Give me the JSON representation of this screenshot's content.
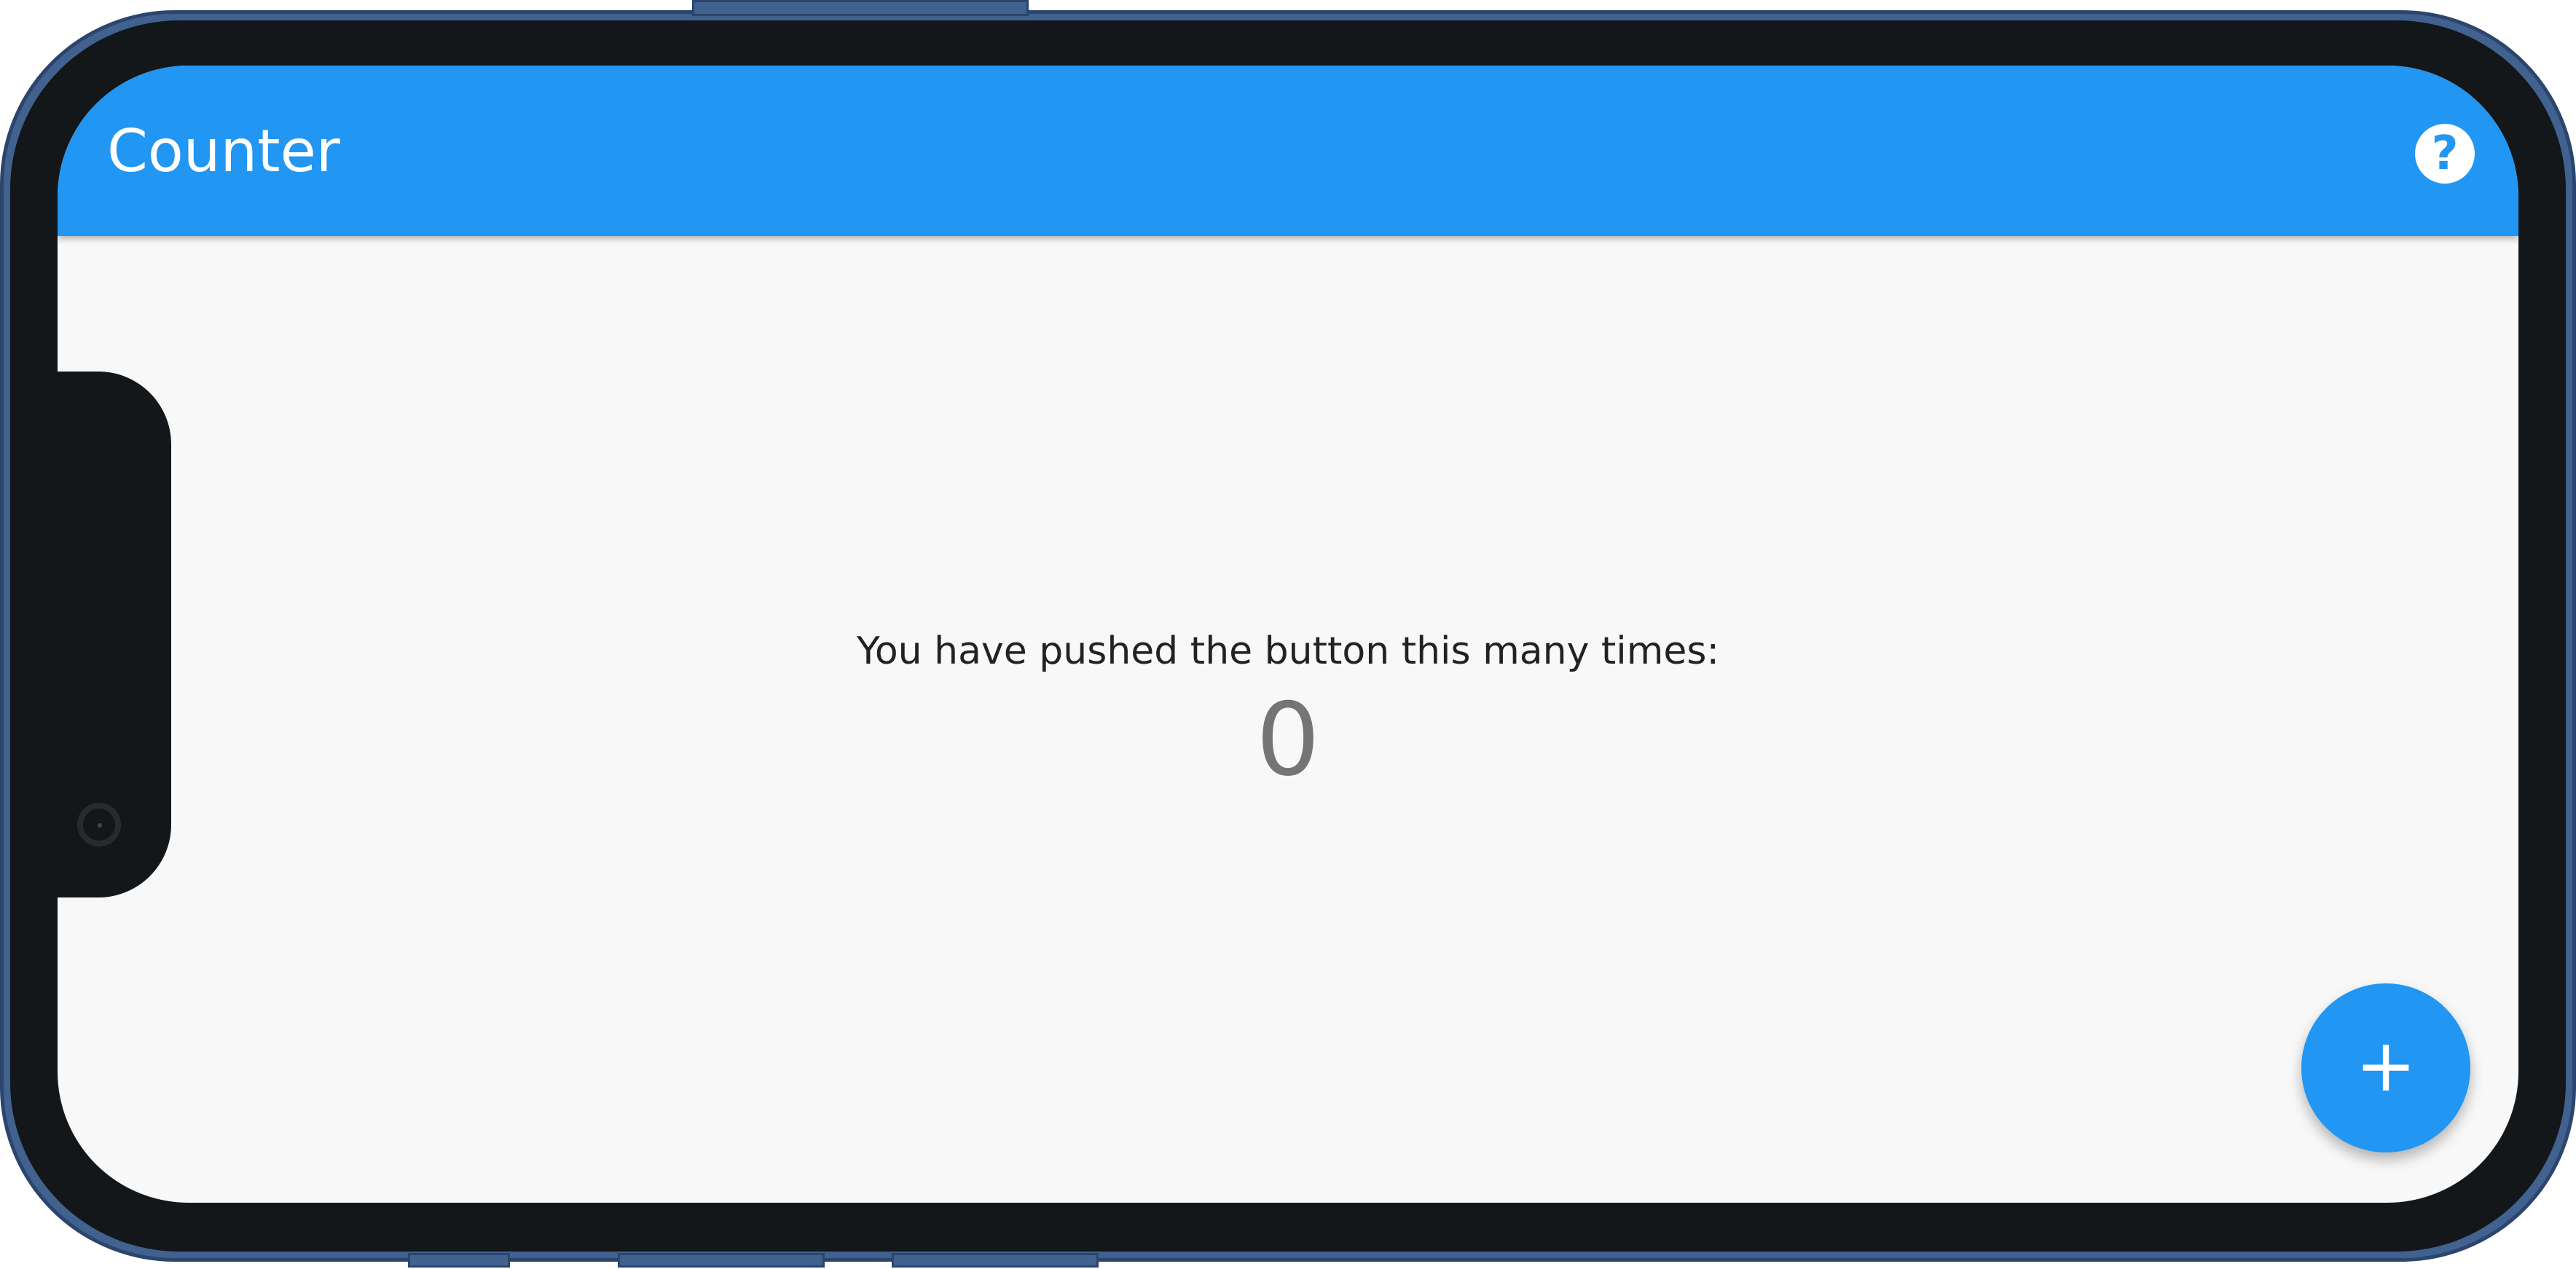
{
  "app": {
    "title": "Counter"
  },
  "appbar": {
    "help_icon": "help-circle-icon",
    "help_glyph": "?"
  },
  "body": {
    "message": "You have pushed the button this many times:",
    "counter": "0"
  },
  "fab": {
    "icon": "plus-icon",
    "glyph": "+"
  },
  "colors": {
    "primary": "#2196f3",
    "background": "#f8f8f8",
    "device_frame": "#41618f",
    "bezel": "#131719",
    "counter_text": "#757575"
  }
}
